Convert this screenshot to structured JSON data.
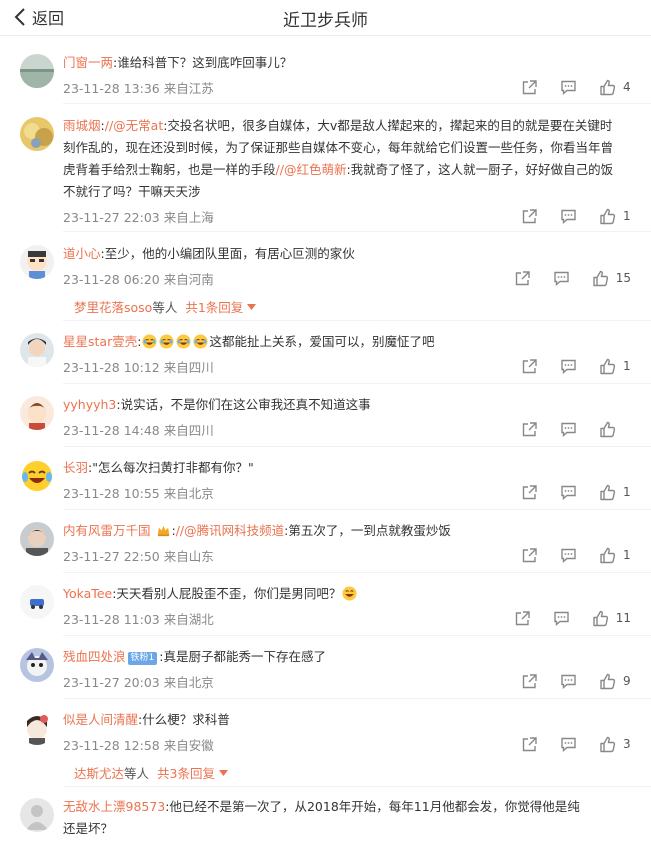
{
  "header": {
    "back_label": "返回",
    "title": "近卫步兵师"
  },
  "comments": [
    {
      "name": "门窗一两",
      "body": ":谁给科普下？这到底咋回事儿？",
      "time": "23-11-28 13:36",
      "location": "来自江苏",
      "likes": "4"
    },
    {
      "name": "雨城烟",
      "sep": ":",
      "mention1": "//@无常at",
      "body1": ":交投名状吧，很多自媒体，大v都是敌人撵起来的，撵起来的目的就是要在关键时刻作乱的，现在还没到时候，为了保证那些自媒体不变心，每年就给它们设置一些任务，你看当年曾虎背着手给烈士鞠躬，也是一样的手段",
      "mention2": "//@红色萌新",
      "body2": ":我就奇了怪了，这人就一厨子，好好做自己的饭不就行了吗？干嘛天天涉",
      "time": "23-11-27 22:03",
      "location": "来自上海",
      "likes": "1"
    },
    {
      "name": "道小心",
      "body": ":至少，他的小编团队里面，有居心叵测的家伙",
      "time": "23-11-28 06:20",
      "location": "来自河南",
      "likes": "15",
      "sub_name": "梦里花落soso",
      "sub_others": " 等人",
      "sub_more": "共1条回复"
    },
    {
      "name": "星星star壹壳",
      "body": "这都能扯上关系，爱国可以，别魔怔了吧",
      "time": "23-11-28 10:12",
      "location": "来自四川",
      "likes": "1"
    },
    {
      "name": "yyhyyh3",
      "body": ":说实话，不是你们在这公审我还真不知道这事",
      "time": "23-11-28 14:48",
      "location": "来自四川",
      "likes": ""
    },
    {
      "name": "长羽",
      "body": ":\"怎么每次扫黄打非都有你？\"",
      "time": "23-11-28 10:55",
      "location": "来自北京",
      "likes": "1"
    },
    {
      "name": "内有风雷万千国",
      "mention1": "//@腾讯网科技频道",
      "body": ":第五次了，一到点就教蛋炒饭",
      "time": "23-11-27 22:50",
      "location": "来自山东",
      "likes": "1"
    },
    {
      "name": "YokaTee",
      "body": ":天天看别人屁股歪不歪，你们是男同吧？",
      "time": "23-11-28 11:03",
      "location": "来自湖北",
      "likes": "11"
    },
    {
      "name": "残血四处浪",
      "badge": "铁粉1",
      "body": ":真是厨子都能秀一下存在感了",
      "time": "23-11-27 20:03",
      "location": "来自北京",
      "likes": "9"
    },
    {
      "name": "似是人间清醒",
      "body": ":什么梗？求科普",
      "time": "23-11-28 12:58",
      "location": "来自安徽",
      "likes": "3",
      "sub_name": "达斯尤达",
      "sub_others": " 等人",
      "sub_more": "共3条回复"
    },
    {
      "name": "无敌水上漂98573",
      "body": ":他已经不是第一次了，从2018年开始，每年11月他都会发，你觉得他是纯",
      "body_line2": "还是坏？"
    }
  ],
  "colors": {
    "accent": "#eb7350",
    "meta": "#888888",
    "badge": "#6aa6e8"
  },
  "icons": [
    "chevron-left-icon",
    "share-icon",
    "comment-icon",
    "like-icon",
    "caret-down-icon",
    "crying-laugh-emoji",
    "grinning-emoji"
  ]
}
